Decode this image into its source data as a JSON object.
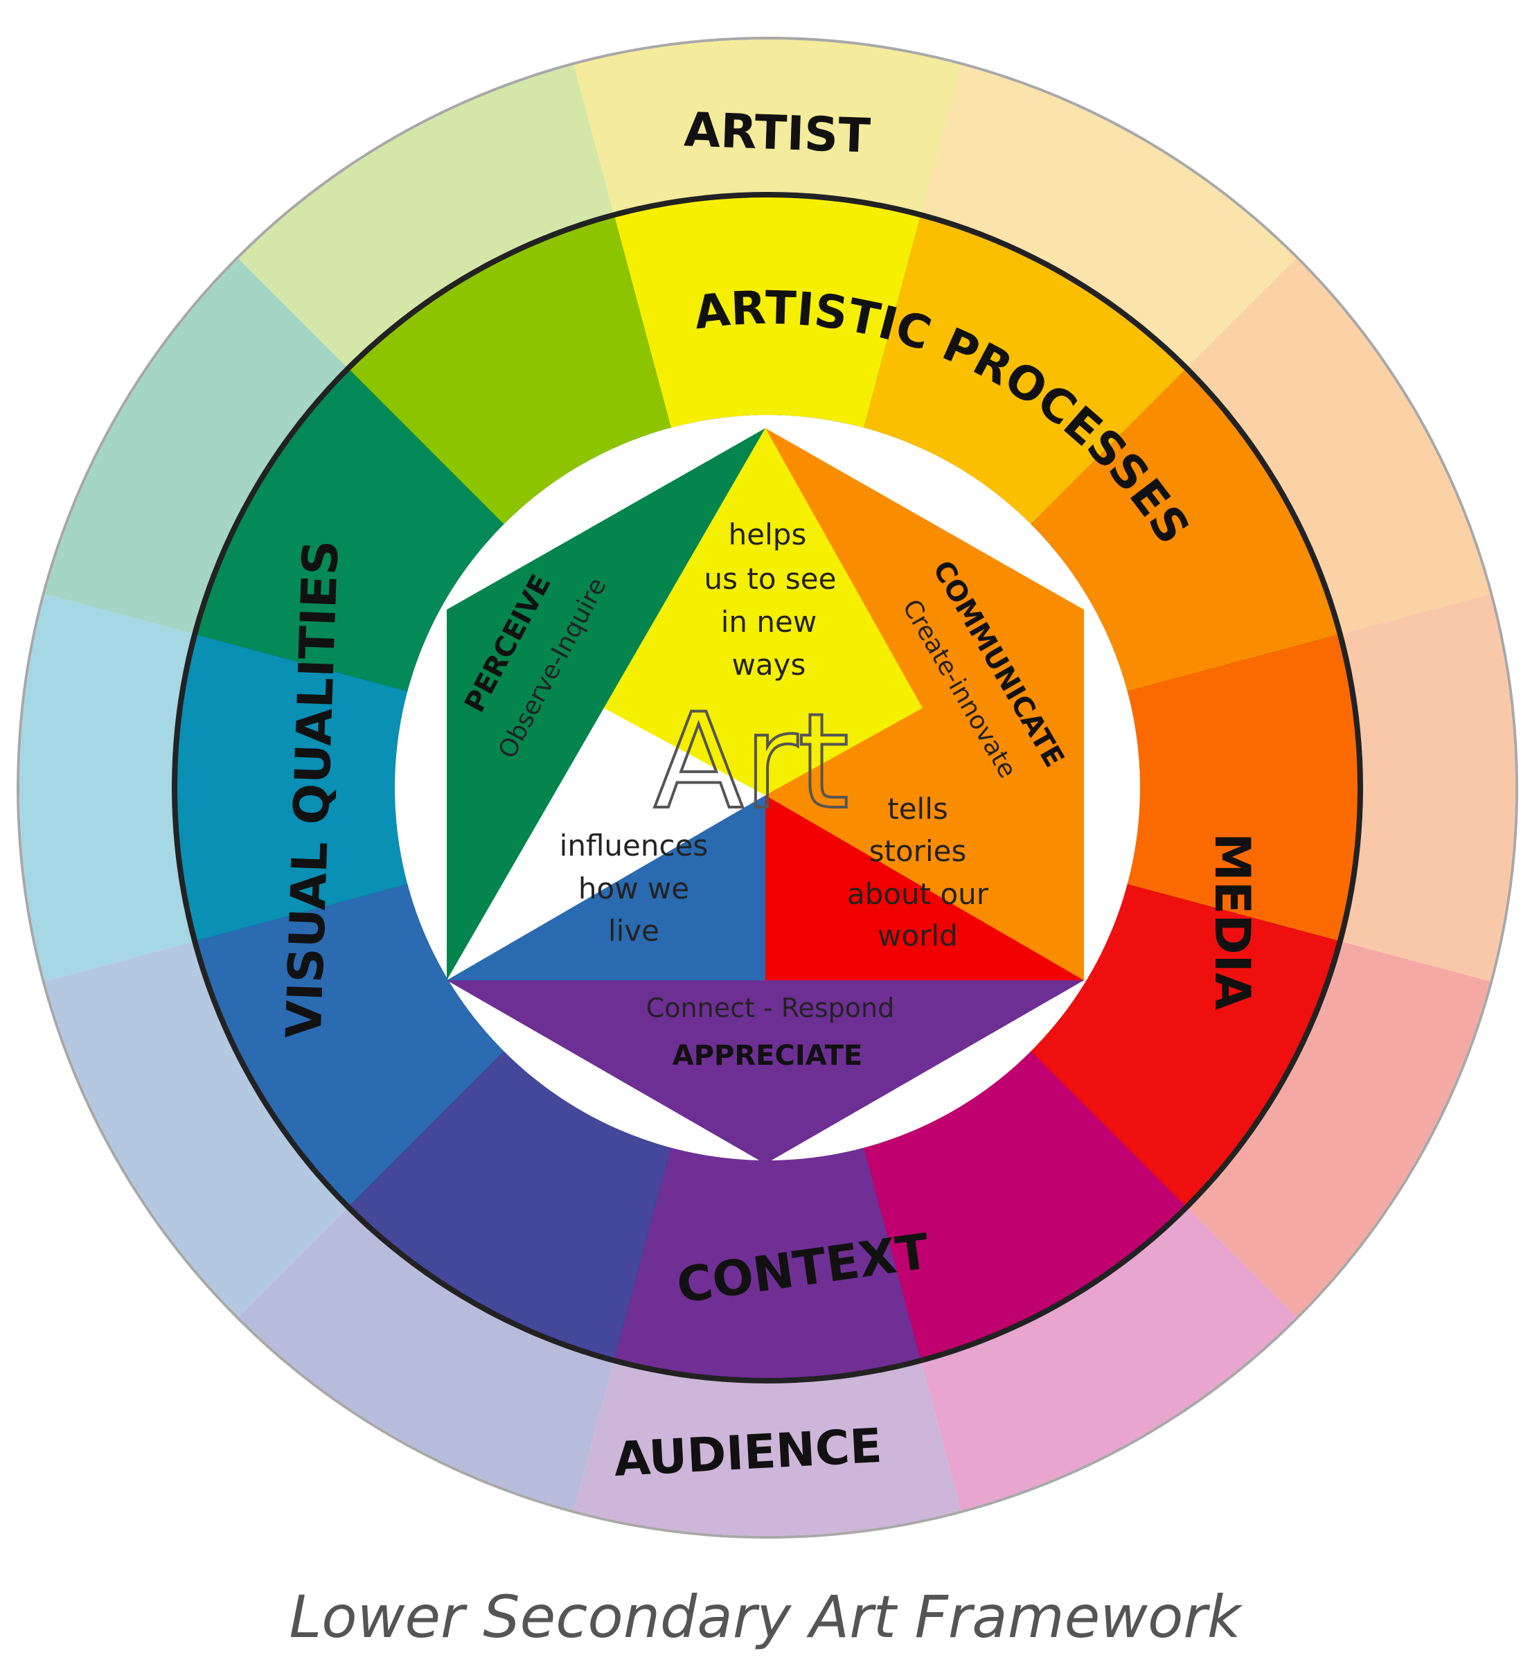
{
  "outer_ring": {
    "colors": [
      "#f4eb9c",
      "#fbe3ac",
      "#fbd2a6",
      "#f9c8a8",
      "#f5a9a5",
      "#e7a5cf",
      "#cdb6d9",
      "#b8bcdc",
      "#b4c8e2",
      "#a6d7e4",
      "#a4d5c5",
      "#d4e7a8"
    ],
    "top_label": "ARTIST",
    "bottom_label": "AUDIENCE"
  },
  "inner_ring": {
    "colors": [
      "#f7ef00",
      "#fbbf00",
      "#fa8c00",
      "#fb6a00",
      "#ef0f0f",
      "#c1006f",
      "#702f95",
      "#45479b",
      "#2a6bb2",
      "#0a8fb5",
      "#048a58",
      "#8cc400"
    ],
    "labels": {
      "processes": "ARTISTIC PROCESSES",
      "media": "MEDIA",
      "context": "CONTEXT",
      "visual": "VISUAL QUALITIES"
    }
  },
  "hexagon": {
    "center_word": "Art",
    "yellow": {
      "color": "#f5ef00",
      "lines": [
        "helps",
        "us to see",
        "in new",
        "ways"
      ]
    },
    "orange": {
      "color": "#fa8c00",
      "title": "COMMUNICATE",
      "subtitle": "Create-innovate"
    },
    "red": {
      "color": "#f20000",
      "lines": [
        "tells",
        "stories",
        "about our",
        "world"
      ]
    },
    "purple": {
      "color": "#6d2f94",
      "subtitle": "Connect - Respond",
      "title": "APPRECIATE"
    },
    "blue": {
      "color": "#2a6ab0",
      "lines": [
        "influences",
        "how we",
        "live"
      ]
    },
    "green": {
      "color": "#04854e",
      "title": "PERCEIVE",
      "subtitle": "Observe-Inquire"
    }
  },
  "caption": "Lower Secondary Art Framework"
}
